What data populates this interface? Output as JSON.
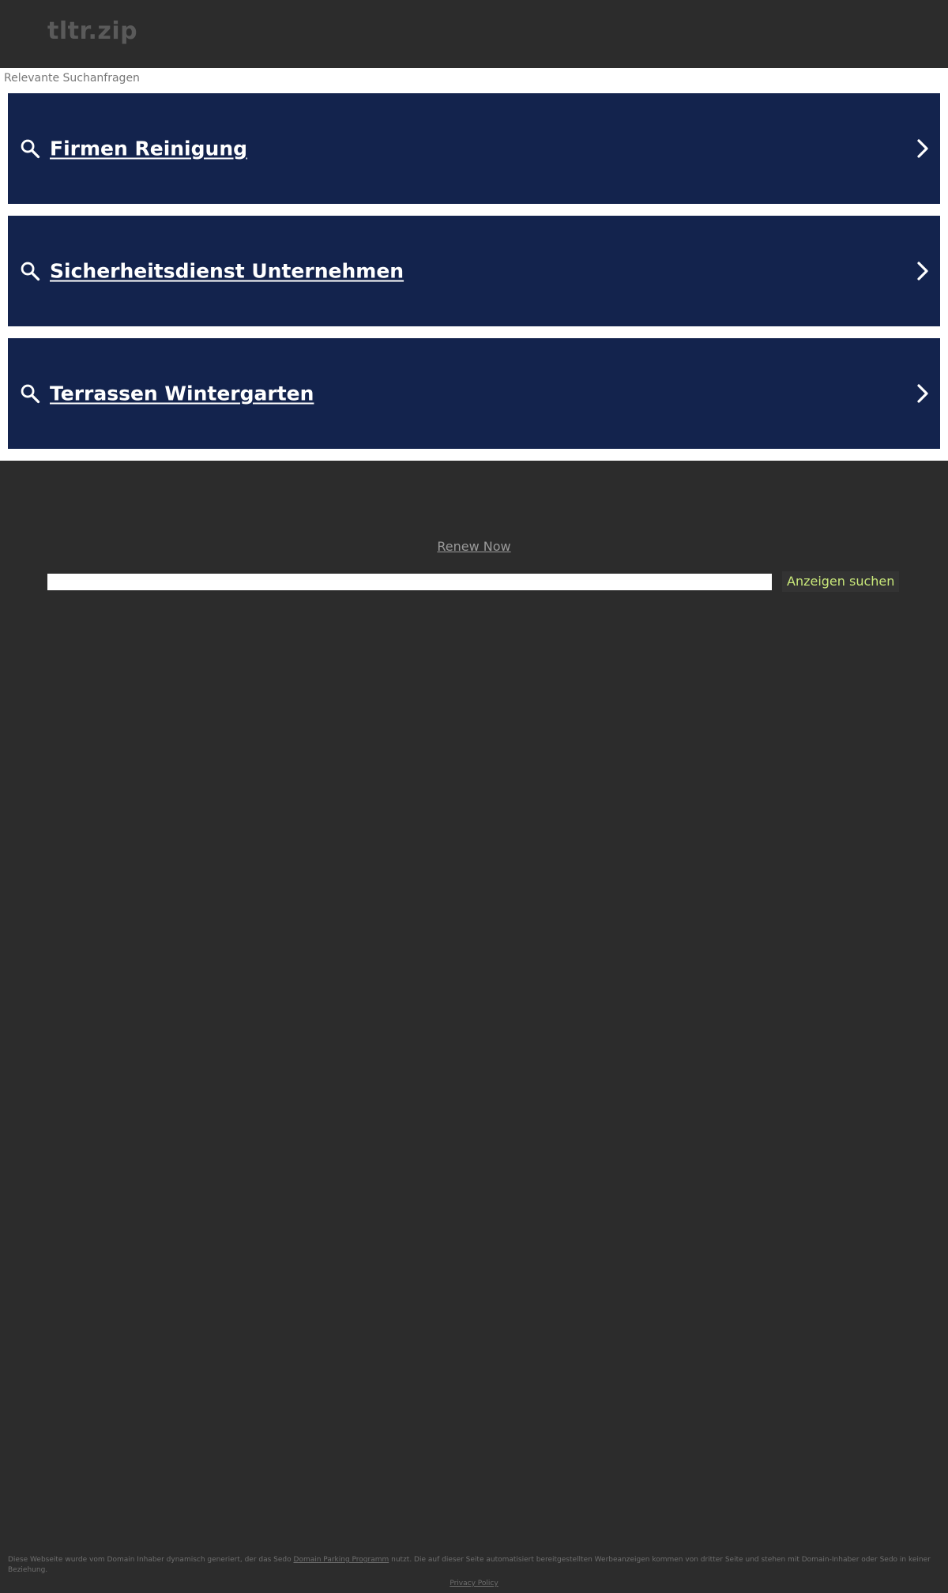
{
  "header": {
    "domain": "tltr.zip"
  },
  "ads": {
    "heading": "Relevante Suchanfragen",
    "items": [
      {
        "label": "Firmen Reinigung"
      },
      {
        "label": "Sicherheitsdienst Unternehmen"
      },
      {
        "label": "Terrassen Wintergarten"
      }
    ]
  },
  "renew": {
    "label": "Renew Now"
  },
  "search": {
    "input_value": "",
    "placeholder": "",
    "button_label": "Anzeigen suchen"
  },
  "footer": {
    "text_before": "Diese Webseite wurde vom Domain Inhaber dynamisch generiert, der das Sedo ",
    "link_label": "Domain Parking Programm",
    "text_after": " nutzt. Die auf dieser Seite automatisiert bereitgestellten Werbeanzeigen kommen von dritter Seite und stehen mit Domain-Inhaber oder Sedo in keiner Beziehung.",
    "privacy_label": "Privacy Policy"
  },
  "colors": {
    "page_background": "#2c2c2c",
    "ad_block": "#13234d",
    "ads_area_background": "#ffffff",
    "search_button_text": "#c9e87a"
  },
  "icons": {
    "ad_search": "search-icon",
    "ad_arrow": "chevron-right-icon"
  }
}
